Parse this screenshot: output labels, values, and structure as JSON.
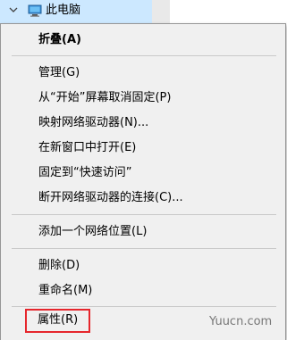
{
  "tree": {
    "item_label": "此电脑",
    "expand_icon": "chevron-down-icon",
    "pc_icon": "computer-icon"
  },
  "context_menu": {
    "items": [
      {
        "label": "折叠(A)",
        "bold": true
      },
      {
        "label": "管理(G)"
      },
      {
        "label": "从“开始”屏幕取消固定(P)"
      },
      {
        "label": "映射网络驱动器(N)..."
      },
      {
        "label": "在新窗口中打开(E)"
      },
      {
        "label": "固定到“快速访问”"
      },
      {
        "label": "断开网络驱动器的连接(C)..."
      },
      {
        "label": "添加一个网络位置(L)"
      },
      {
        "label": "删除(D)"
      },
      {
        "label": "重命名(M)"
      },
      {
        "label": "属性(R)",
        "highlighted": true
      }
    ]
  },
  "annotation": {
    "highlight_color": "#e6262c"
  },
  "watermark": {
    "text": "Yuucn.com"
  },
  "colors": {
    "menu_bg": "#f0f0f0",
    "selection_bg": "#cce8ff"
  }
}
